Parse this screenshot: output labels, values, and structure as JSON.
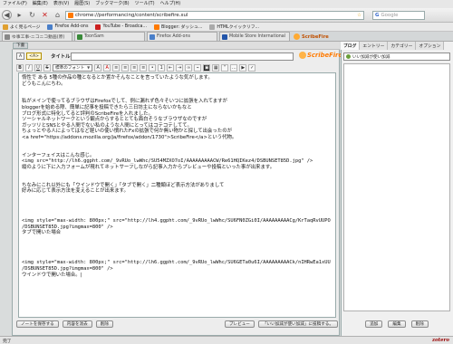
{
  "menu": [
    "ファイル(F)",
    "編集(E)",
    "表示(V)",
    "履歴(S)",
    "ブックマーク(B)",
    "ツール(T)",
    "ヘルプ(H)"
  ],
  "nav": {
    "url": "chrome://performancing/content/scribefire.xul",
    "search_placeholder": "Google"
  },
  "bookmarks": [
    {
      "label": "よく見るページ",
      "color": "#e0a030"
    },
    {
      "label": "Firefox Add-ons",
      "color": "#4a7fc9"
    },
    {
      "label": "YouTube - Broadca...",
      "color": "#cc2020"
    },
    {
      "label": "Blogger: ダッシュ...",
      "color": "#ff7a00"
    },
    {
      "label": "HTMLクイックリフ...",
      "color": "#aaa"
    }
  ],
  "tabs": [
    {
      "label": "ゆ事工事-ニコニコ動画(原)",
      "active": false
    },
    {
      "label": "ToonSam",
      "active": false
    },
    {
      "label": "Firefox Add-ons",
      "active": false
    },
    {
      "label": "Mobile Store International",
      "active": false
    }
  ],
  "scribefire_tab": "ScribeFire",
  "draft_button": "下書",
  "editor": {
    "wysiwyg_label": "A",
    "source_label": "<A>",
    "title_label": "タイトル:",
    "title_value": "",
    "logo": "ScribeFire",
    "font_select": "標準のフォント",
    "lines": [
      {
        "t": "惰性で ある 5種の作品の種となるとか置かそんなことを言っていたような気がします。",
        "jp": true
      },
      {
        "t": "どうもこんにちわ。",
        "jp": true
      },
      {
        "t": "",
        "jp": true
      },
      {
        "t": "",
        "jp": true
      },
      {
        "t": "私がメインで使ってるブラウザはFirefoxでして、例に漏れず色々そいつに拡張を入れてますが",
        "jp": true
      },
      {
        "t": "bloggerを始める際、簡単に記事を投稿できたら三日坊主にならないかもなと",
        "jp": true
      },
      {
        "t": "ブログ形式に特化してると評判のScribeFireを入れました。",
        "jp": true
      },
      {
        "t": "ソーシャルネットワークという観点からするととても面白そうなブラウザなのですが",
        "jp": true
      },
      {
        "t": "ガッツリとSNSとやる人間でない私のような人間にとってはコテコテしてて。",
        "jp": true
      },
      {
        "t": "ちょっとやる人によってはなど軽いの使い慣れたFxの拡張で何か無い物かと探して出会ったのが",
        "jp": true
      },
      {
        "t": "<a href=\"https://addons.mozilla.org/ja/firefox/addon/1730\">ScribeFire</a>という代物。",
        "jp": true
      },
      {
        "t": "",
        "jp": true
      },
      {
        "t": "",
        "jp": true
      },
      {
        "t": "インターフェイスはこんな感じ。",
        "jp": true
      },
      {
        "t": "<img src=\"http://lh6.ggpht.com/_9vRUo_lwWhc/SU54MZXO7oI/AAAAAAAAACW/Re61HQIKez4/DSBUNSET85D.jpg\" />",
        "jp": false
      },
      {
        "t": "縦のように下に入力フォームが現れてネットサーフしながら記事入力からプレビューや投稿といった事が出来ます。",
        "jp": true
      },
      {
        "t": "",
        "jp": true
      },
      {
        "t": "",
        "jp": true
      },
      {
        "t": "ちなみにこれ以外にも「ウインドウで開く」「タブで開く」二種類ほど表示方法がありまして",
        "jp": true
      },
      {
        "t": "好みに応じて表示方法を変えることが出来ます。",
        "jp": true
      },
      {
        "t": "",
        "jp": true
      },
      {
        "t": "",
        "jp": true
      },
      {
        "t": "",
        "jp": true
      },
      {
        "t": "",
        "jp": true
      },
      {
        "t": "<img style=\"max-width: 800px;\" src=\"http://lh4.ggpht.com/_9vRUo_lwWhc/SU6FN0ZGi0I/AAAAAAAAACg/KrTaqRvUUPO",
        "jp": false
      },
      {
        "t": "/DSBUNSET85D.jpg?imgmax=800\" />",
        "jp": false
      },
      {
        "t": "タブで開いた場合",
        "jp": true
      },
      {
        "t": "",
        "jp": true
      },
      {
        "t": "",
        "jp": true
      },
      {
        "t": "",
        "jp": true
      },
      {
        "t": "",
        "jp": true
      },
      {
        "t": "<img style=\"max-width: 800px;\" src=\"http://lh6.ggpht.com/_9vRUo_lwWhc/SU6GETa0u6I/AAAAAAAAACk/nIHRwEa1xUU",
        "jp": false
      },
      {
        "t": "/DSBUNSET85D.jpg?imgmax=800\" />",
        "jp": false
      },
      {
        "t": "ウインドウで開いた場合。|",
        "jp": true
      }
    ]
  },
  "bottom_buttons": {
    "save_note": "ノートを保存する",
    "clear": "内容を消去",
    "delete": "削除",
    "preview": "プレビュー",
    "publish": "「いい加減が使い加減」に投稿する。"
  },
  "sidebar": {
    "tabs": [
      "ブログ",
      "エントリー",
      "カテゴリー",
      "オプション"
    ],
    "blog": "いい加減が使い加減",
    "buttons": [
      "追加",
      "編集",
      "削除"
    ]
  },
  "status": {
    "left": "完了",
    "right": "zotero"
  }
}
